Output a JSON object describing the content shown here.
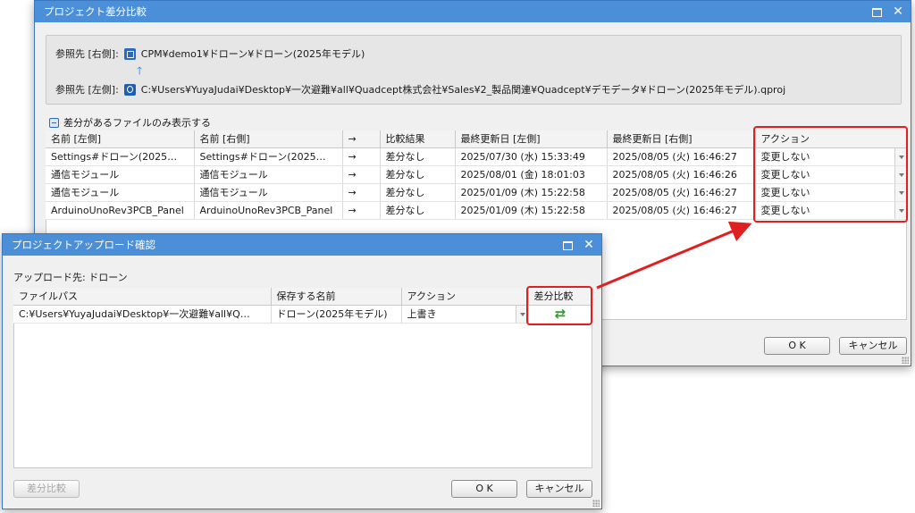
{
  "main": {
    "title": "プロジェクト差分比較",
    "ref_right_label": "参照先 [右側]:",
    "ref_right_path": "CPM¥demo1¥ドローン¥ドローン(2025年モデル)",
    "ref_left_label": "参照先 [左側]:",
    "ref_left_path": "C:¥Users¥YuyaJudai¥Desktop¥一次避難¥all¥Quadcept株式会社¥Sales¥2_製品関連¥Quadcept¥デモデータ¥ドローン(2025年モデル).qproj",
    "filter_label": "差分があるファイルのみ表示する",
    "columns": [
      "名前 [左側]",
      "名前 [右側]",
      "→",
      "比較結果",
      "最終更新日 [左側]",
      "最終更新日 [右側]",
      "アクション"
    ],
    "rows": [
      {
        "left": "Settings#ドローン(2025…",
        "right": "Settings#ドローン(2025…",
        "arrow": "→",
        "result": "差分なし",
        "date_left": "2025/07/30 (水) 15:33:49",
        "date_right": "2025/08/05 (火) 16:46:27",
        "action": "変更しない"
      },
      {
        "left": "通信モジュール",
        "right": "通信モジュール",
        "arrow": "→",
        "result": "差分なし",
        "date_left": "2025/08/01 (金) 18:01:03",
        "date_right": "2025/08/05 (火) 16:46:26",
        "action": "変更しない"
      },
      {
        "left": "通信モジュール",
        "right": "通信モジュール",
        "arrow": "→",
        "result": "差分なし",
        "date_left": "2025/01/09 (木) 15:22:58",
        "date_right": "2025/08/05 (火) 16:46:27",
        "action": "変更しない"
      },
      {
        "left": "ArduinoUnoRev3PCB_Panel",
        "right": "ArduinoUnoRev3PCB_Panel",
        "arrow": "→",
        "result": "差分なし",
        "date_left": "2025/01/09 (木) 15:22:58",
        "date_right": "2025/08/05 (火) 16:46:27",
        "action": "変更しない"
      }
    ],
    "ok_label": "O K",
    "cancel_label": "キャンセル"
  },
  "upload": {
    "title": "プロジェクトアップロード確認",
    "dest_label": "アップロード先: ドローン",
    "columns": [
      "ファイルパス",
      "保存する名前",
      "アクション",
      "差分比較"
    ],
    "rows": [
      {
        "path": "C:¥Users¥YuyaJudai¥Desktop¥一次避難¥all¥Q…",
        "name": "ドローン(2025年モデル)",
        "action": "上書き"
      }
    ],
    "diff_button_label": "差分比較",
    "ok_label": "O K",
    "cancel_label": "キャンセル"
  },
  "colors": {
    "titlebar": "#4a8fd8",
    "highlight": "#e02020",
    "swap_icon": "#2e9e2e"
  }
}
